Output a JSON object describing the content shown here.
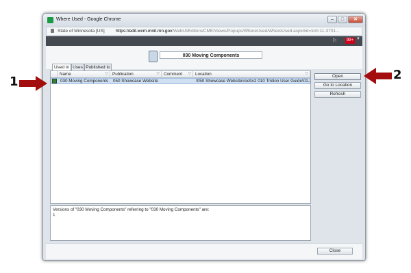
{
  "window": {
    "title": "Where Used - Google Chrome",
    "controls": [
      "–",
      "□",
      "✕"
    ]
  },
  "address_bar": {
    "organization": "State of Minnesota [US]",
    "url_host": "https://edit.wcm.mnit.mn.gov",
    "url_path": "/WebUI/Editors/CME/Views/Popups/WhereUsed/WhereUsed.aspx#id=tcm:11-3701..."
  },
  "top_band": {
    "notification_count": "99+"
  },
  "header": {
    "item_title": "030 Moving Components"
  },
  "tabs": [
    {
      "label": "Used in",
      "active": true
    },
    {
      "label": "Uses",
      "active": false
    },
    {
      "label": "Published to",
      "active": false
    }
  ],
  "grid": {
    "columns": [
      "Name",
      "Publication",
      "Comment",
      "Location"
    ],
    "rows": [
      {
        "name": "030 Moving Components",
        "publication": "050 Showcase Website",
        "comment": "",
        "location": "\\050 Showcase Website\\root\\v2 010 Tridion User Guide\\01..."
      }
    ]
  },
  "info": {
    "line1": "Versions of \"030 Moving Components\" referring to \"030 Moving Components\" are:",
    "line2": "1"
  },
  "actions": {
    "open": "Open",
    "goto": "Go to Location",
    "refresh": "Refresh",
    "close": "Close"
  },
  "callouts": {
    "left": "1",
    "right": "2",
    "arrow_color": "#a30d0d"
  }
}
